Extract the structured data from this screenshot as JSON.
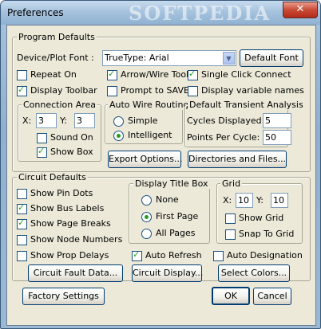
{
  "window": {
    "title": "Preferences",
    "watermark": "SOFTPEDIA",
    "close_glyph": "✕"
  },
  "program_defaults": {
    "legend": "Program Defaults",
    "font_label": "Device/Plot Font :",
    "font_value": "TrueType: Arial",
    "default_font_button": "Default Font",
    "options": {
      "repeat_on": {
        "label": "Repeat On",
        "checked": false
      },
      "arrow_wire_tool": {
        "label": "Arrow/Wire Tool",
        "checked": true
      },
      "single_click_connect": {
        "label": "Single Click Connect",
        "checked": true
      },
      "display_toolbar": {
        "label": "Display Toolbar",
        "checked": true
      },
      "prompt_to_save": {
        "label": "Prompt to SAVE",
        "checked": false
      },
      "display_variable_names": {
        "label": "Display variable names",
        "checked": false
      }
    },
    "connection_area": {
      "legend": "Connection Area",
      "x_label": "X:",
      "x_value": "3",
      "y_label": "Y:",
      "y_value": "3",
      "sound_on": {
        "label": "Sound On",
        "checked": false
      },
      "show_box": {
        "label": "Show Box",
        "checked": true
      }
    },
    "auto_wire_routing": {
      "legend": "Auto Wire Routing",
      "simple": {
        "label": "Simple",
        "selected": false
      },
      "intelligent": {
        "label": "Intelligent",
        "selected": true
      }
    },
    "transient": {
      "legend": "Default Transient Analysis",
      "cycles_label": "Cycles Displayed:",
      "cycles_value": "5",
      "points_label": "Points Per Cycle:",
      "points_value": "50"
    },
    "export_options_button": "Export Options...",
    "directories_button": "Directories and Files..."
  },
  "circuit_defaults": {
    "legend": "Circuit Defaults",
    "show_pin_dots": {
      "label": "Show Pin Dots",
      "checked": false
    },
    "show_bus_labels": {
      "label": "Show Bus Labels",
      "checked": true
    },
    "show_page_breaks": {
      "label": "Show Page Breaks",
      "checked": true
    },
    "show_node_numbers": {
      "label": "Show Node Numbers",
      "checked": false
    },
    "show_prop_delays": {
      "label": "Show Prop Delays",
      "checked": false
    },
    "display_title_box": {
      "legend": "Display Title Box",
      "none": {
        "label": "None",
        "selected": false
      },
      "first_page": {
        "label": "First Page",
        "selected": true
      },
      "all_pages": {
        "label": "All Pages",
        "selected": false
      }
    },
    "grid": {
      "legend": "Grid",
      "x_label": "X:",
      "x_value": "10",
      "y_label": "Y:",
      "y_value": "10",
      "show_grid": {
        "label": "Show Grid",
        "checked": false
      },
      "snap_to_grid": {
        "label": "Snap To Grid",
        "checked": false
      }
    },
    "auto_refresh": {
      "label": "Auto Refresh",
      "checked": true
    },
    "auto_designation": {
      "label": "Auto Designation",
      "checked": false
    },
    "circuit_fault_button": "Circuit Fault Data...",
    "circuit_display_button": "Circuit Display...",
    "select_colors_button": "Select Colors..."
  },
  "footer": {
    "factory_settings_button": "Factory Settings",
    "ok_button": "OK",
    "cancel_button": "Cancel"
  }
}
